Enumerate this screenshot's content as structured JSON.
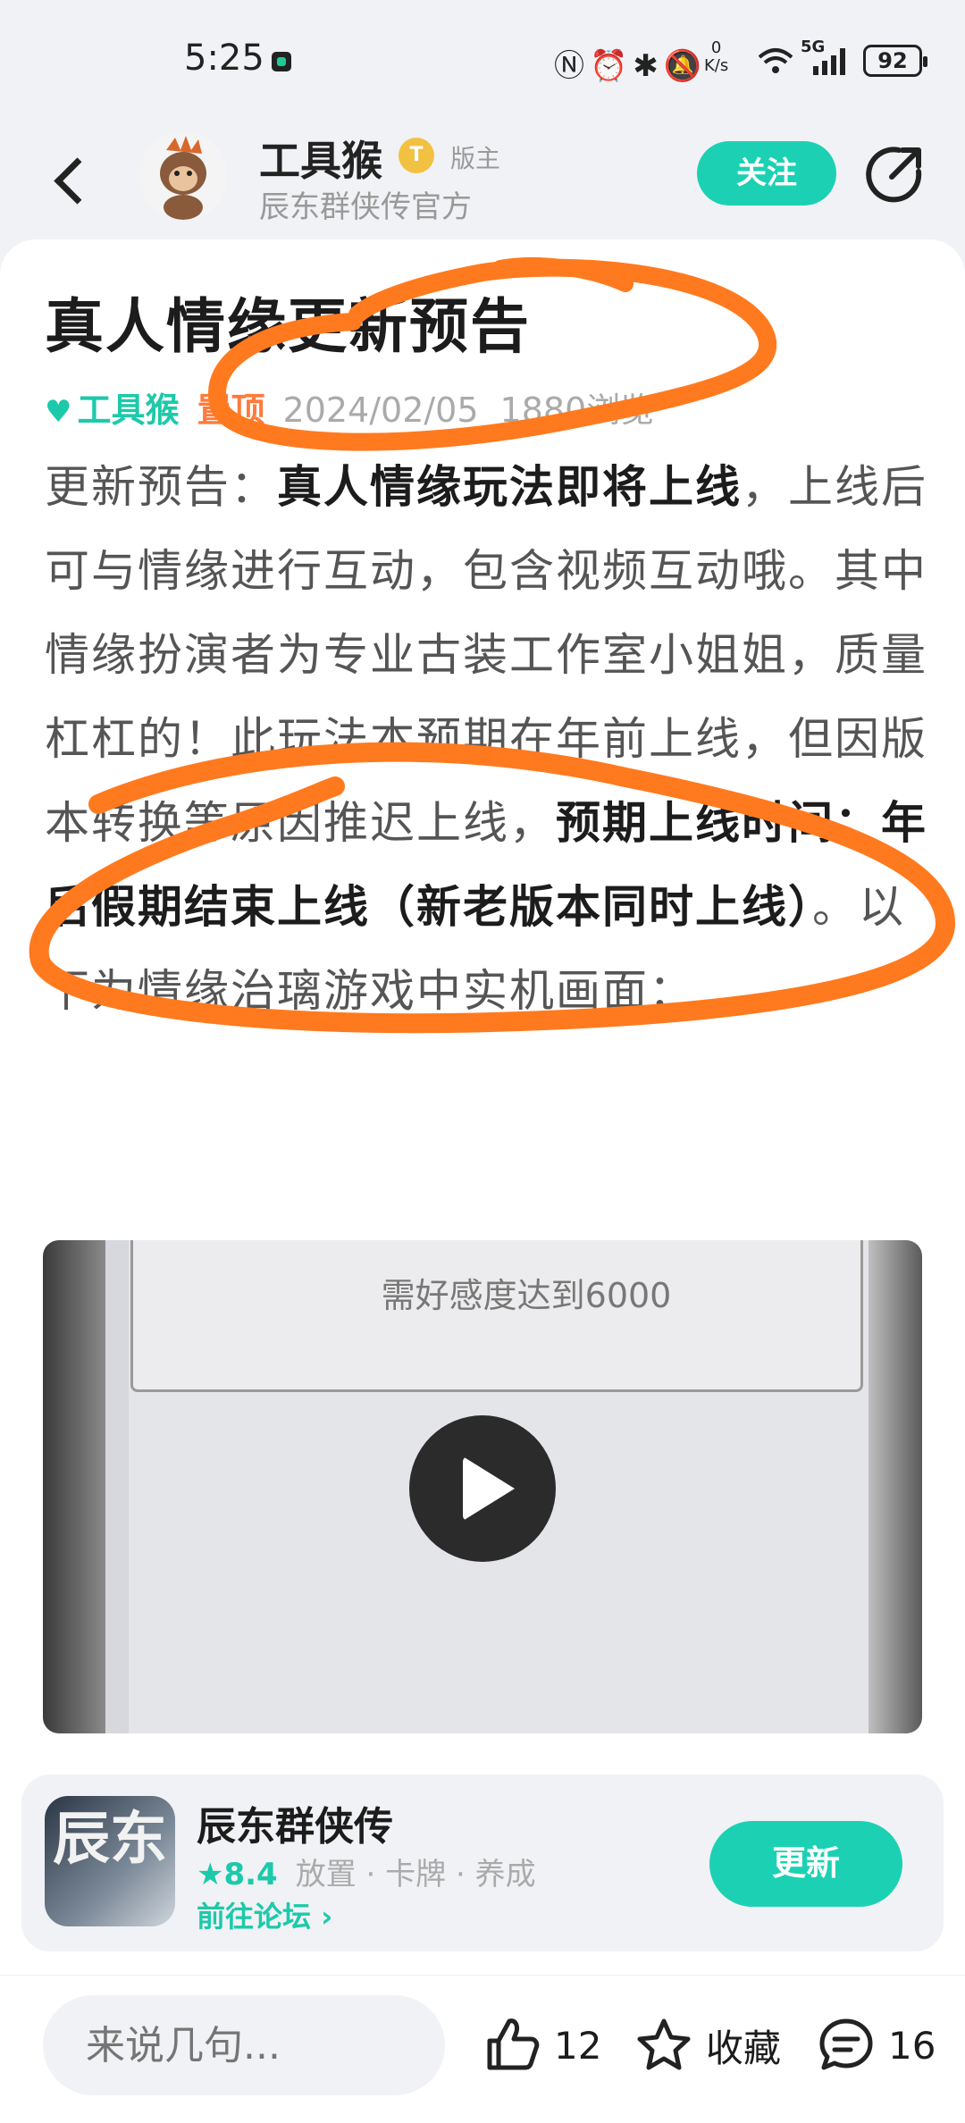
{
  "status_bar": {
    "time": "5:25",
    "net_speed_value": "0",
    "net_speed_unit": "K/s",
    "signal": "5G",
    "battery": "92"
  },
  "header": {
    "author_name": "工具猴",
    "badge": "T",
    "role": "版主",
    "subtitle": "辰东群侠传官方",
    "follow_label": "关注"
  },
  "post": {
    "title": "真人情缘更新预告",
    "author": "工具猴",
    "pinned": "置顶",
    "date": "2024/02/05",
    "views": "1880浏览",
    "body": [
      {
        "text": "更新预告：",
        "bold": false
      },
      {
        "text": "真人情缘玩法即将上线",
        "bold": true
      },
      {
        "text": "，上线后可与情缘进行互动，包含视频互动哦。其中情缘扮演者为专业古装工作室小姐姐，质量杠杠的！此玩法本预期在年前上线，但因版本转换等原因推迟上线，",
        "bold": false
      },
      {
        "text": "预期上线时间：年后假期结束上线（新老版本同时上线）",
        "bold": true
      },
      {
        "text": "。以下为情缘治璃游戏中实机画面：",
        "bold": false
      }
    ]
  },
  "video": {
    "caption": "需好感度达到6000"
  },
  "app_card": {
    "icon_text": "辰东",
    "name": "辰东群侠传",
    "rating": "8.4",
    "tags": "放置 · 卡牌 · 养成",
    "forum_link": "前往论坛 ›",
    "update_label": "更新"
  },
  "bottom_bar": {
    "comment_placeholder": "来说几句...",
    "likes": "12",
    "favorite_label": "收藏",
    "comments": "16"
  },
  "colors": {
    "accent": "#1cd1b3",
    "pin": "#ff7a3b",
    "scribble": "#ff7a1f"
  }
}
